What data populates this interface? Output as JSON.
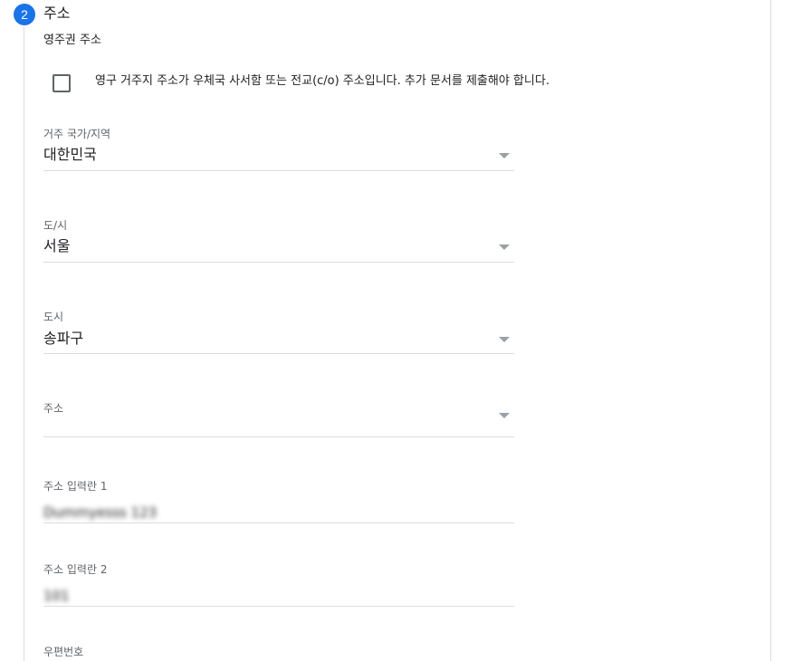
{
  "step": {
    "number": "2",
    "title": "주소"
  },
  "section_title": "영주권 주소",
  "checkbox": {
    "label": "영구 거주지 주소가 우체국 사서함 또는 전교(c/o) 주소입니다. 추가 문서를 제출해야 합니다.",
    "checked": false
  },
  "fields": {
    "country": {
      "label": "거주 국가/지역",
      "value": "대한민국"
    },
    "province": {
      "label": "도/시",
      "value": "서울"
    },
    "city": {
      "label": "도시",
      "value": "송파구"
    },
    "address": {
      "label": "주소",
      "value": ""
    },
    "address_line1": {
      "label": "주소 입력란 1",
      "value": "Dummyesss 123"
    },
    "address_line2": {
      "label": "주소 입력란 2",
      "value": "101"
    },
    "postal_code": {
      "label": "우편번호",
      "value": ""
    }
  },
  "colors": {
    "accent": "#1a73e8",
    "divider": "#dadce0",
    "label": "#5f6368"
  }
}
